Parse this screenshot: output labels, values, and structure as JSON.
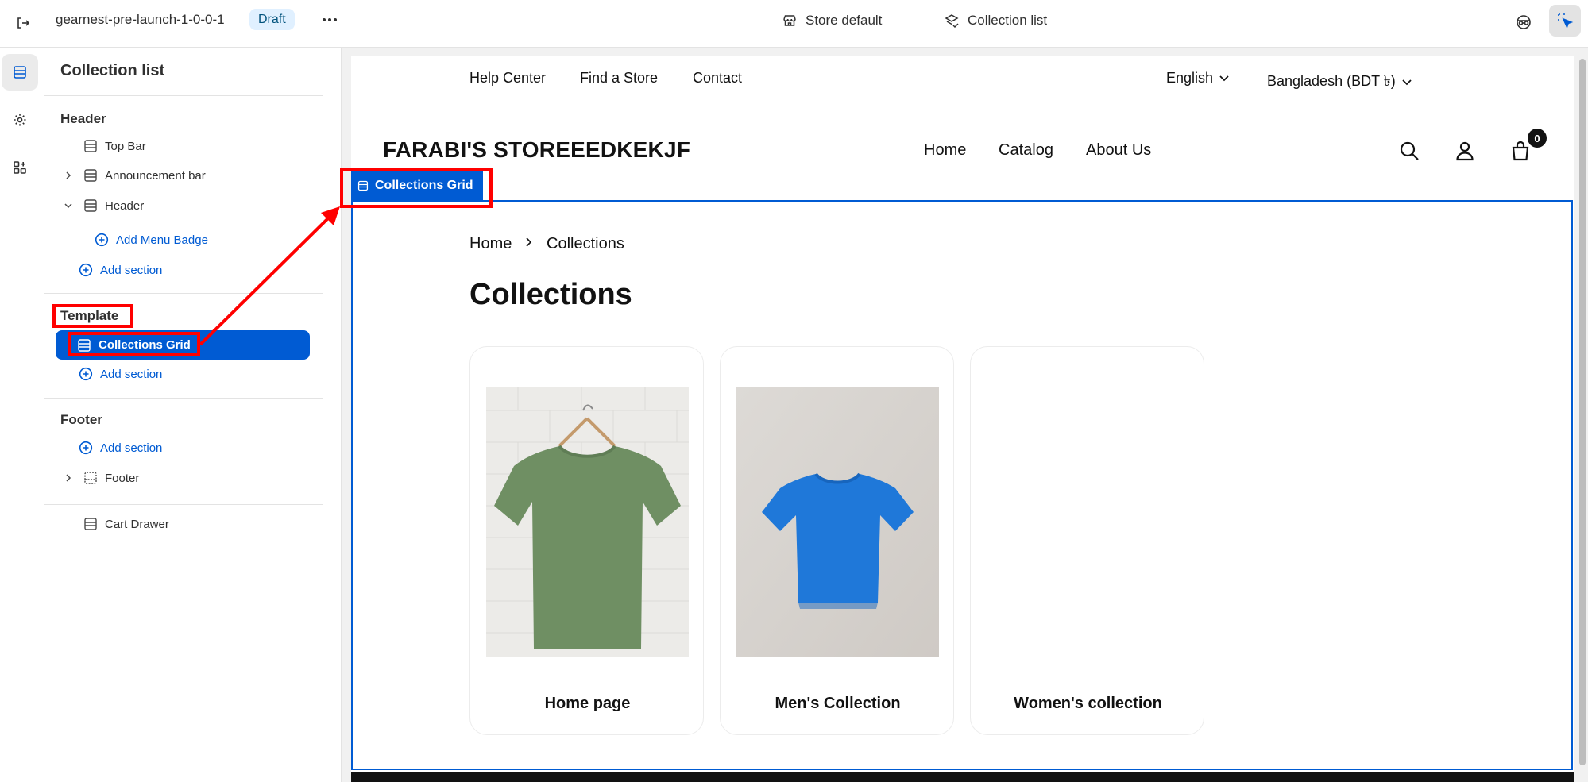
{
  "topbar": {
    "theme_name": "gearnest-pre-launch-1-0-0-1",
    "status_badge": "Draft",
    "store_selector": "Store default",
    "page_selector": "Collection list"
  },
  "sidebar": {
    "title": "Collection list",
    "groups": {
      "header": {
        "label": "Header",
        "items": [
          "Top Bar",
          "Announcement bar",
          "Header"
        ],
        "add_block": "Add Menu Badge",
        "add_section": "Add section"
      },
      "template": {
        "label": "Template",
        "items": [
          "Collections Grid"
        ],
        "add_section": "Add section"
      },
      "footer": {
        "label": "Footer",
        "add_section": "Add section",
        "items": [
          "Footer"
        ]
      },
      "overlays": {
        "items": [
          "Cart Drawer"
        ]
      }
    }
  },
  "preview": {
    "top_links": [
      "Help Center",
      "Find a Store",
      "Contact"
    ],
    "language": "English",
    "currency": "Bangladesh (BDT ৳)",
    "logo": "FARABI'S STOREEEDKEKJF",
    "nav": [
      "Home",
      "Catalog",
      "About Us"
    ],
    "cart_count": "0",
    "section_tag": "Collections Grid",
    "breadcrumb": [
      "Home",
      "Collections"
    ],
    "heading": "Collections",
    "cards": [
      {
        "title": "Home page",
        "image": "green-tshirt"
      },
      {
        "title": "Men's Collection",
        "image": "blue-tshirt"
      },
      {
        "title": "Women's collection",
        "image": "none"
      }
    ]
  },
  "colors": {
    "accent": "#005bd3",
    "highlight": "#ff0000",
    "badge_bg": "#e0f0ff"
  }
}
